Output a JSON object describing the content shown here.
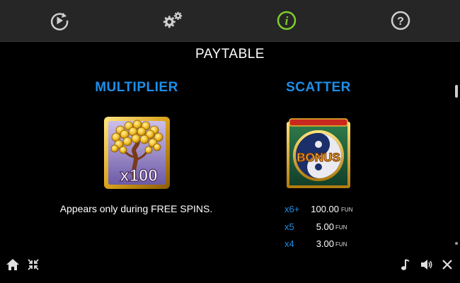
{
  "toolbar": {
    "items": [
      {
        "icon": "autoplay-icon"
      },
      {
        "icon": "settings-gears-icon"
      },
      {
        "icon": "info-icon",
        "active": true,
        "accent": "#7fcf2a"
      },
      {
        "icon": "help-icon"
      }
    ]
  },
  "page": {
    "title": "PAYTABLE"
  },
  "multiplier": {
    "heading": "MULTIPLIER",
    "symbol_text": "x100",
    "description": "Appears only during FREE SPINS."
  },
  "scatter": {
    "heading": "SCATTER",
    "symbol_text": "BONUS",
    "payouts": [
      {
        "count": "x6+",
        "amount": "100.00",
        "unit": "FUN"
      },
      {
        "count": "x5",
        "amount": "5.00",
        "unit": "FUN"
      },
      {
        "count": "x4",
        "amount": "3.00",
        "unit": "FUN"
      }
    ]
  },
  "bottom_bar": {
    "left": [
      "home-icon",
      "minimize-icon"
    ],
    "right": [
      "music-icon",
      "sound-icon",
      "close-icon"
    ]
  },
  "colors": {
    "heading_blue": "#1e8ee8",
    "topbar_bg": "#262626",
    "icon_gray": "#cfcfcf",
    "info_green": "#7fcf2a"
  }
}
